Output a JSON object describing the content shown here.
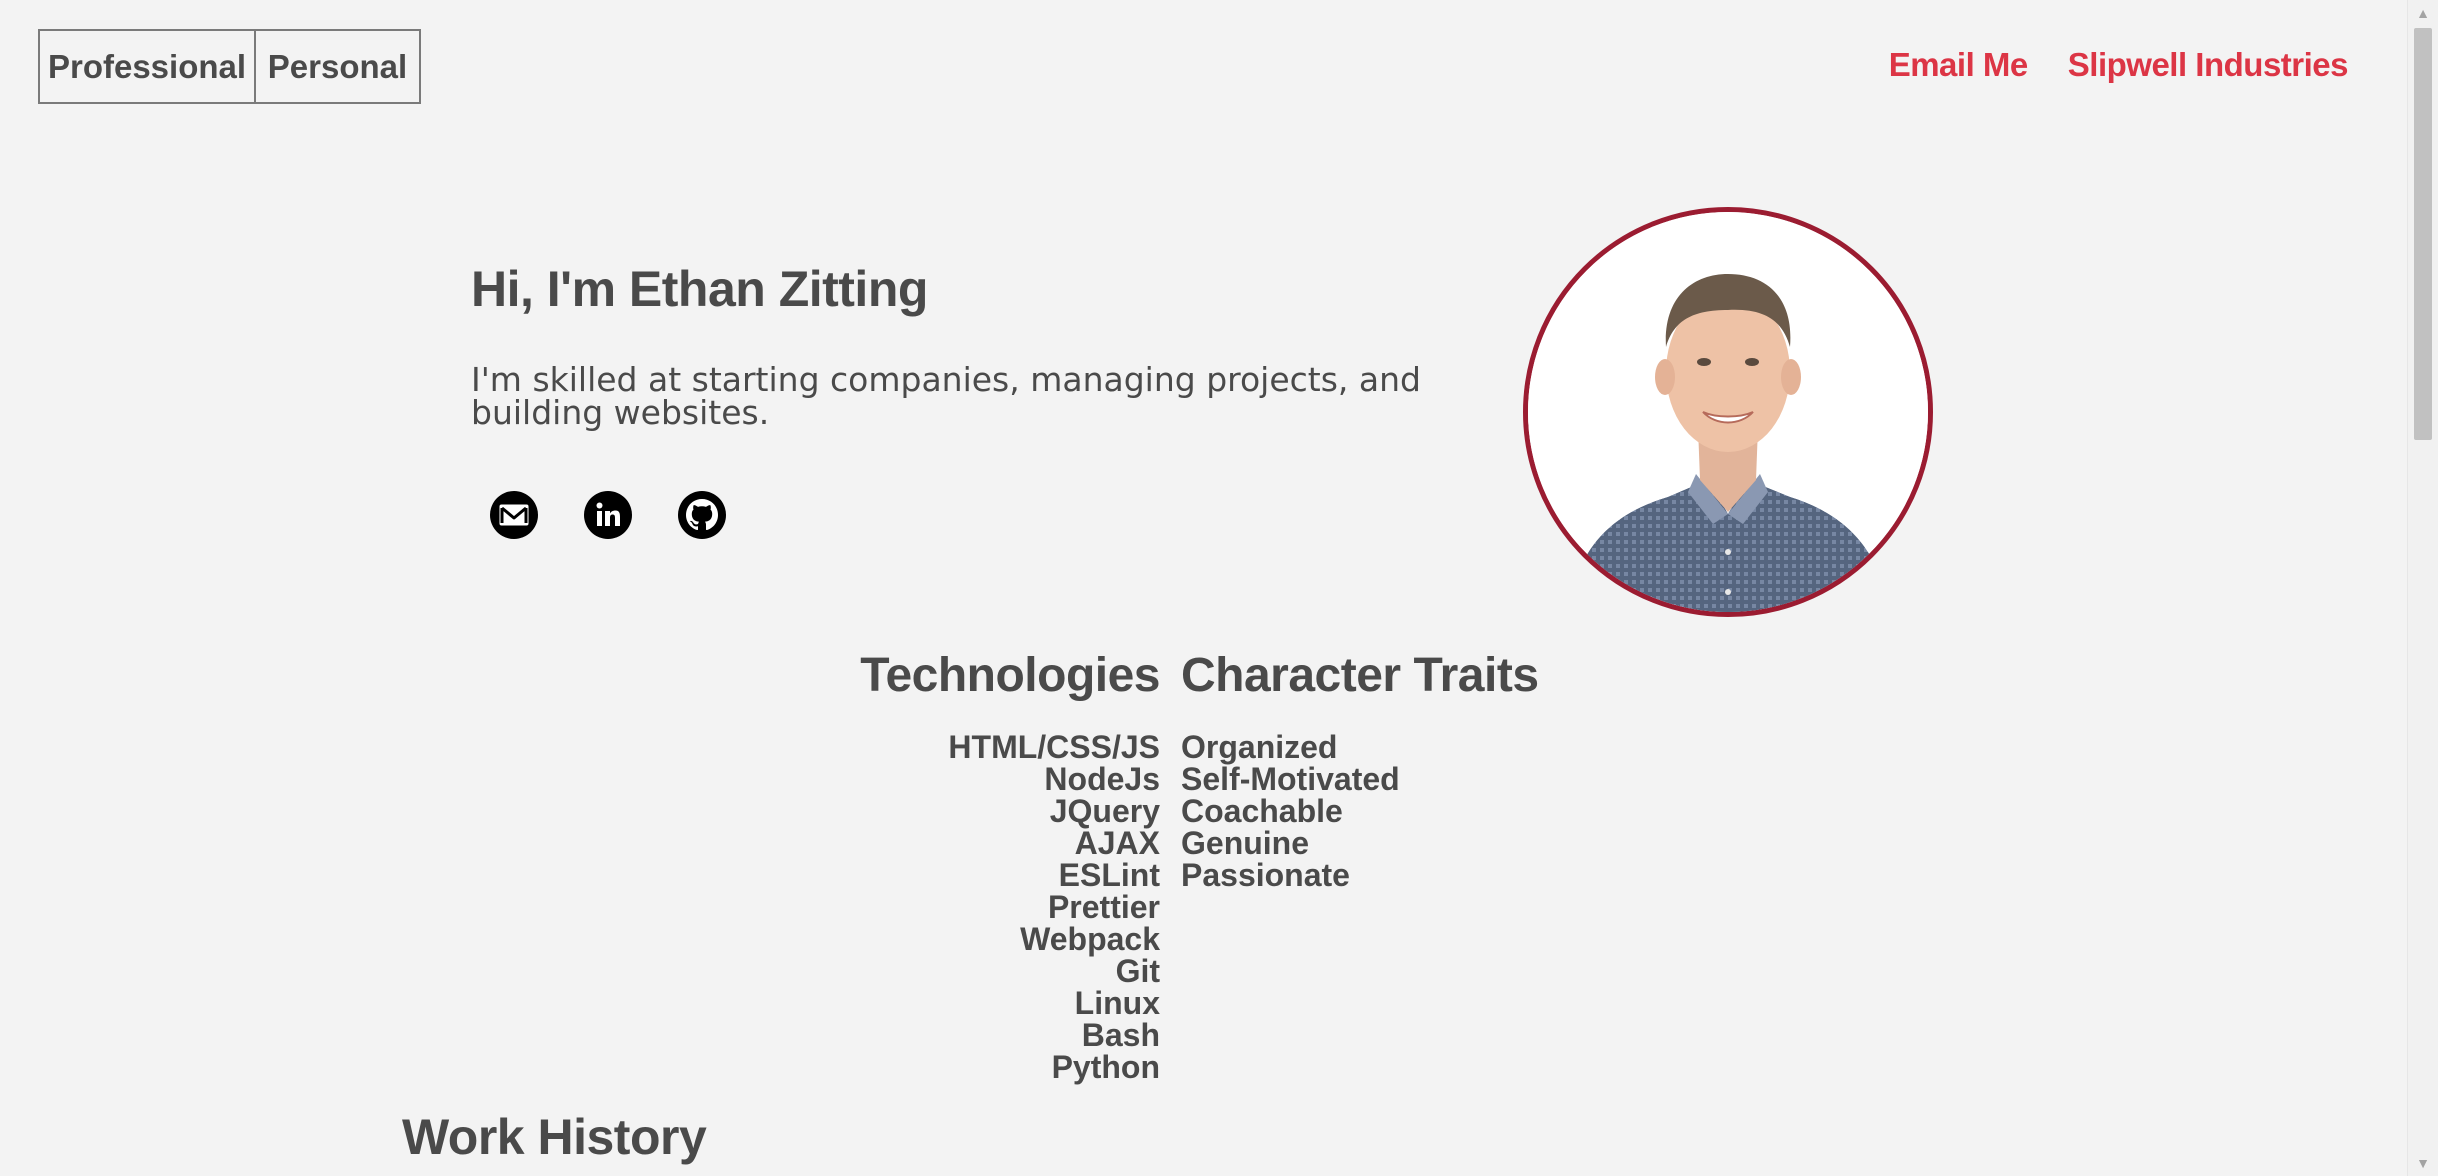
{
  "nav": {
    "toggle": {
      "professional": "Professional",
      "personal": "Personal"
    },
    "links": {
      "email": "Email Me",
      "company": "Slipwell Industries"
    }
  },
  "hero": {
    "title": "Hi, I'm Ethan Zitting",
    "subtitle": "I'm skilled at starting companies, managing projects, and building websites.",
    "social": [
      "email-icon",
      "linkedin-icon",
      "github-icon"
    ]
  },
  "skills": {
    "technologies_title": "Technologies",
    "technologies": [
      "HTML/CSS/JS",
      "NodeJs",
      "JQuery",
      "AJAX",
      "ESLint",
      "Prettier",
      "Webpack",
      "Git",
      "Linux",
      "Bash",
      "Python"
    ],
    "traits_title": "Character Traits",
    "traits": [
      "Organized",
      "Self-Motivated",
      "Coachable",
      "Genuine",
      "Passionate"
    ]
  },
  "work": {
    "title": "Work History"
  },
  "colors": {
    "accent": "#dc3545",
    "avatar_border": "#9b1c31",
    "text": "#4a4a4a",
    "background": "#f3f3f3"
  }
}
